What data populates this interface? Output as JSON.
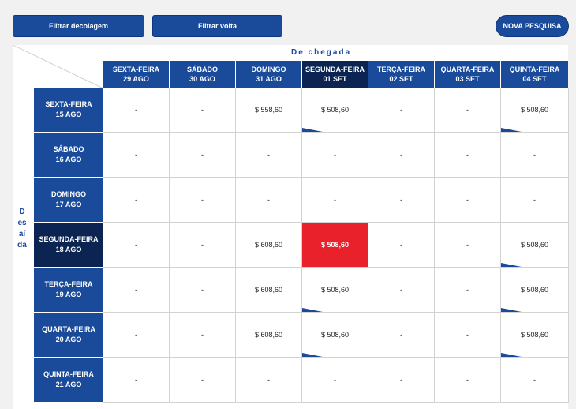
{
  "toolbar": {
    "filter_departure": "Filtrar decolagem",
    "filter_return": "Filtrar volta",
    "new_search": "NOVA PESQUISA"
  },
  "arrival_label": "De chegada",
  "departure_label": "Desaída",
  "columns": [
    {
      "day": "SEXTA-FEIRA",
      "date": "29 AGO"
    },
    {
      "day": "SÁBADO",
      "date": "30 AGO"
    },
    {
      "day": "DOMINGO",
      "date": "31 AGO"
    },
    {
      "day": "SEGUNDA-FEIRA",
      "date": "01 SET"
    },
    {
      "day": "TERÇA-FEIRA",
      "date": "02 SET"
    },
    {
      "day": "QUARTA-FEIRA",
      "date": "03 SET"
    },
    {
      "day": "QUINTA-FEIRA",
      "date": "04 SET"
    }
  ],
  "rows": [
    {
      "day": "SEXTA-FEIRA",
      "date": "15 AGO",
      "cells": [
        "-",
        "-",
        "$ 558,60",
        "$ 508,60",
        "-",
        "-",
        "$ 508,60"
      ]
    },
    {
      "day": "SÁBADO",
      "date": "16 AGO",
      "cells": [
        "-",
        "-",
        "-",
        "-",
        "-",
        "-",
        "-"
      ]
    },
    {
      "day": "DOMINGO",
      "date": "17 AGO",
      "cells": [
        "-",
        "-",
        "-",
        "-",
        "-",
        "-",
        "-"
      ]
    },
    {
      "day": "SEGUNDA-FEIRA",
      "date": "18 AGO",
      "cells": [
        "-",
        "-",
        "$ 608,60",
        "$ 508,60",
        "-",
        "-",
        "$ 508,60"
      ]
    },
    {
      "day": "TERÇA-FEIRA",
      "date": "19 AGO",
      "cells": [
        "-",
        "-",
        "$ 608,60",
        "$ 508,60",
        "-",
        "-",
        "$ 508,60"
      ]
    },
    {
      "day": "QUARTA-FEIRA",
      "date": "20 AGO",
      "cells": [
        "-",
        "-",
        "$ 608,60",
        "$ 508,60",
        "-",
        "-",
        "$ 508,60"
      ]
    },
    {
      "day": "QUINTA-FEIRA",
      "date": "21 AGO",
      "cells": [
        "-",
        "-",
        "-",
        "-",
        "-",
        "-",
        "-"
      ]
    }
  ],
  "selected": {
    "row": 3,
    "col": 3
  },
  "flags": [
    [
      0,
      3
    ],
    [
      0,
      6
    ],
    [
      3,
      6
    ],
    [
      4,
      3
    ],
    [
      4,
      6
    ],
    [
      5,
      3
    ],
    [
      5,
      6
    ]
  ],
  "colors": {
    "primary": "#1a4b9b",
    "selected_header": "#0b2452",
    "selected_cell": "#e8212a"
  }
}
